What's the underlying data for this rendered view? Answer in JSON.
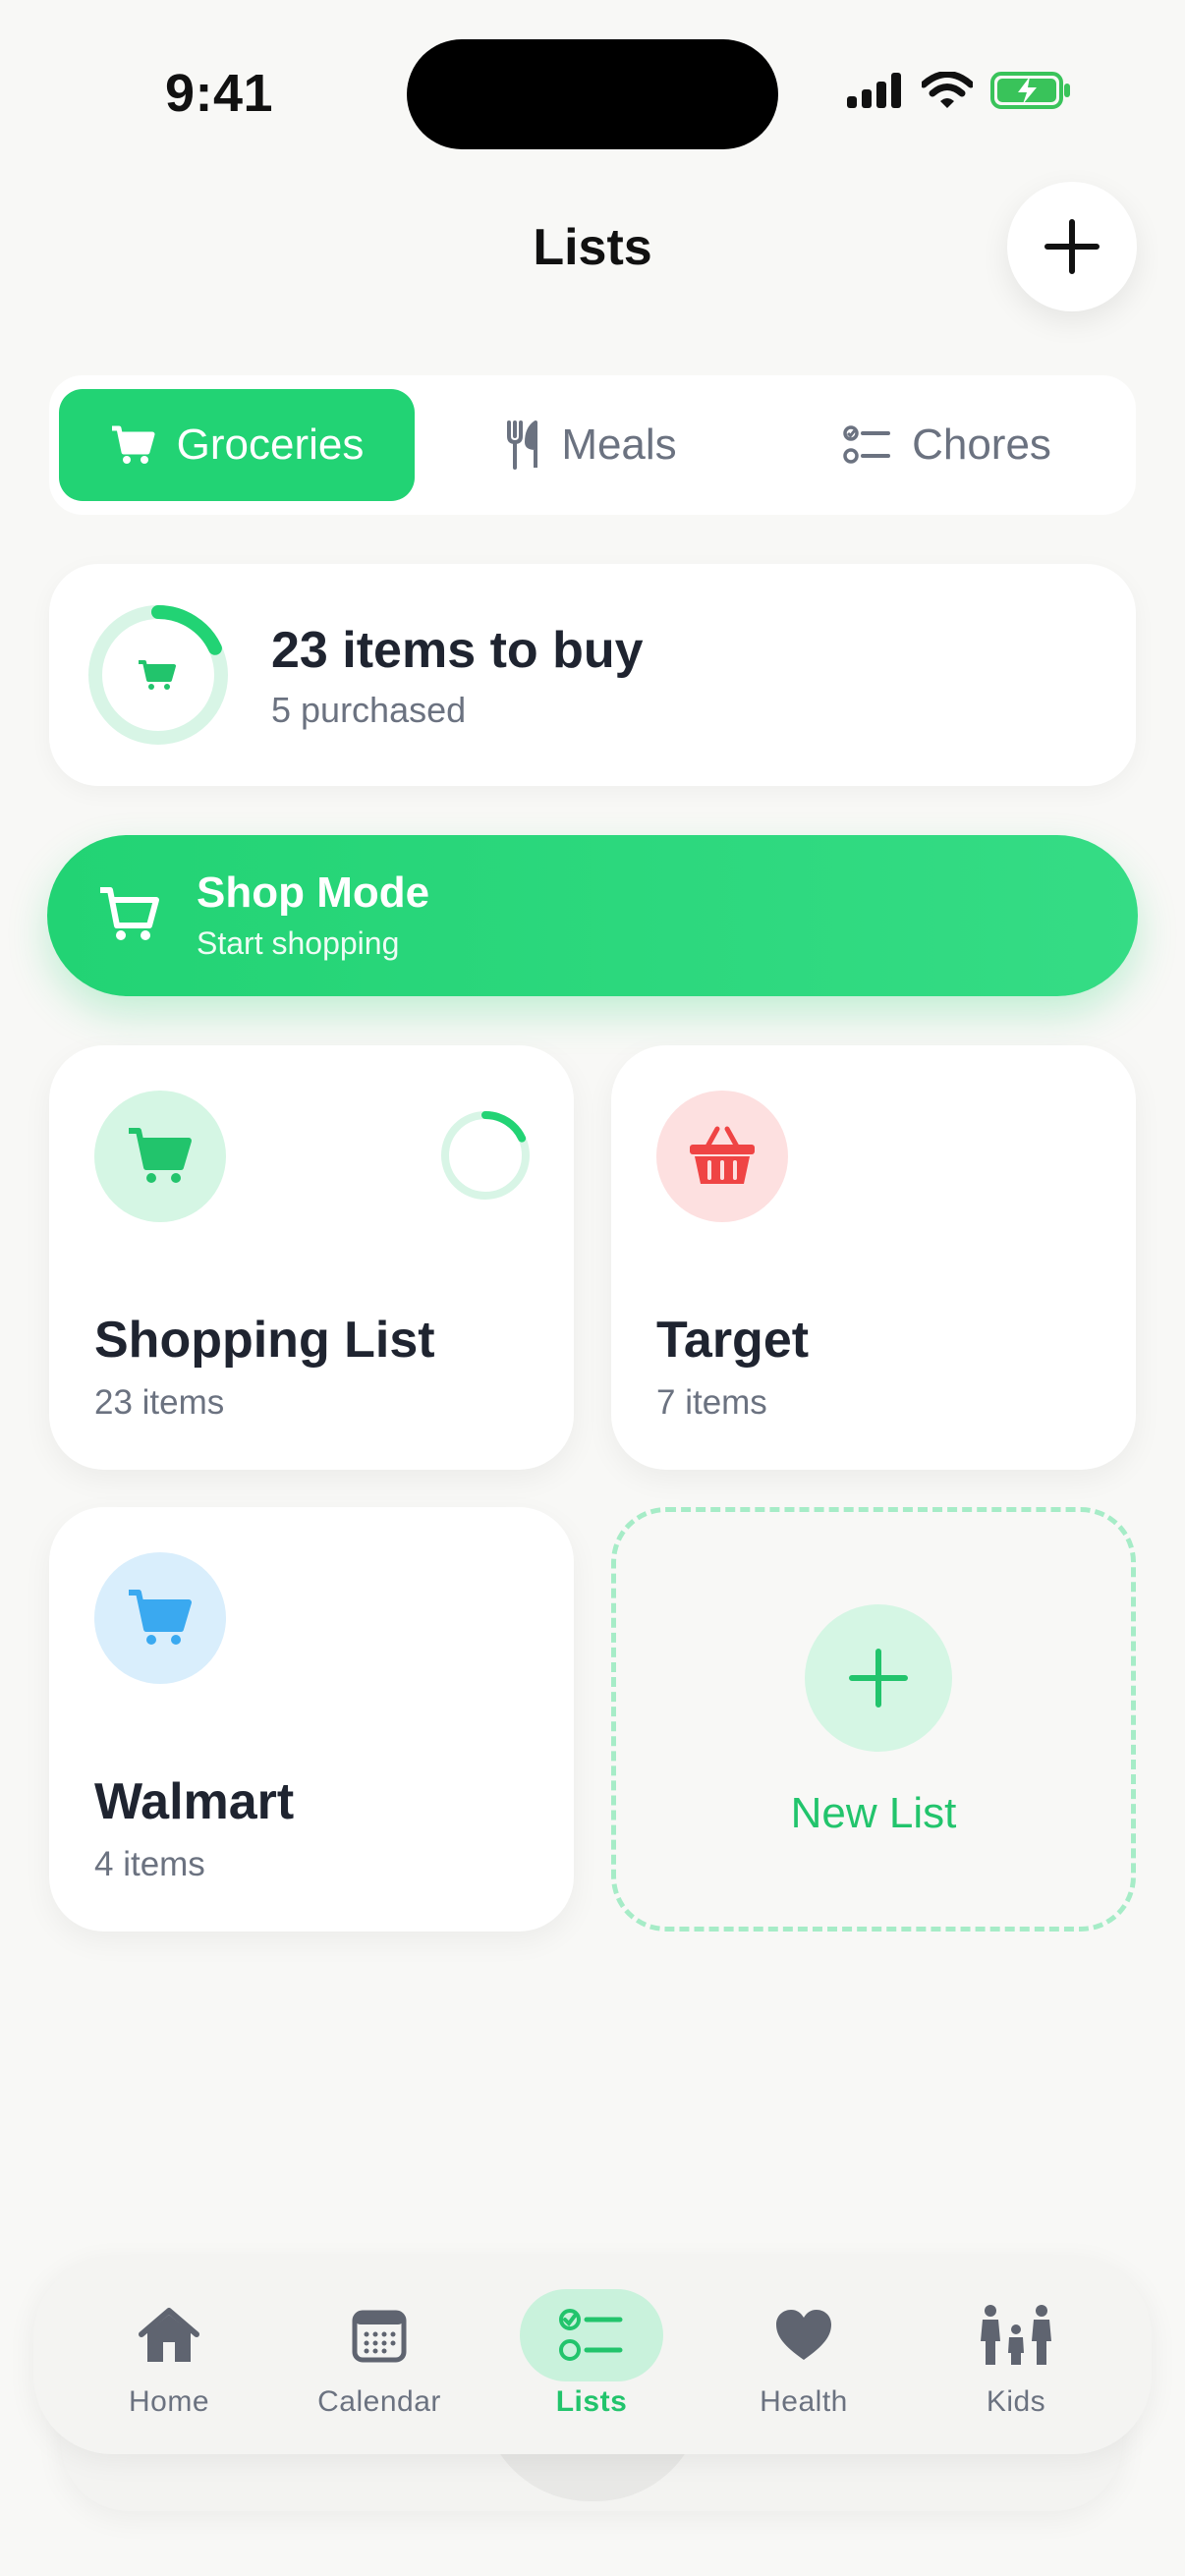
{
  "status": {
    "time": "9:41"
  },
  "header": {
    "title": "Lists"
  },
  "tabs": [
    {
      "label": "Groceries",
      "icon": "cart-icon"
    },
    {
      "label": "Meals",
      "icon": "utensils-icon"
    },
    {
      "label": "Chores",
      "icon": "checklist-icon"
    }
  ],
  "summary": {
    "title": "23 items to buy",
    "subtitle": "5 purchased",
    "progress": 0.18
  },
  "shop_mode": {
    "title": "Shop Mode",
    "subtitle": "Start shopping"
  },
  "lists": [
    {
      "title": "Shopping List",
      "count": "23 items",
      "icon": "cart-icon",
      "color": "#22c46c",
      "bg": "#d5f6e4",
      "progress": 0.18
    },
    {
      "title": "Target",
      "count": "7 items",
      "icon": "basket-icon",
      "color": "#ef4444",
      "bg": "#fde0e0"
    },
    {
      "title": "Walmart",
      "count": "4 items",
      "icon": "cart-icon",
      "color": "#3aa9f0",
      "bg": "#d9eefc"
    }
  ],
  "new_list": {
    "label": "New List"
  },
  "nav": [
    {
      "label": "Home",
      "icon": "home-icon"
    },
    {
      "label": "Calendar",
      "icon": "calendar-icon"
    },
    {
      "label": "Lists",
      "icon": "checklist-icon",
      "active": true
    },
    {
      "label": "Health",
      "icon": "heart-icon"
    },
    {
      "label": "Kids",
      "icon": "family-icon"
    }
  ],
  "colors": {
    "accent": "#22d374",
    "text": "#1f2430",
    "muted": "#6b7280"
  }
}
